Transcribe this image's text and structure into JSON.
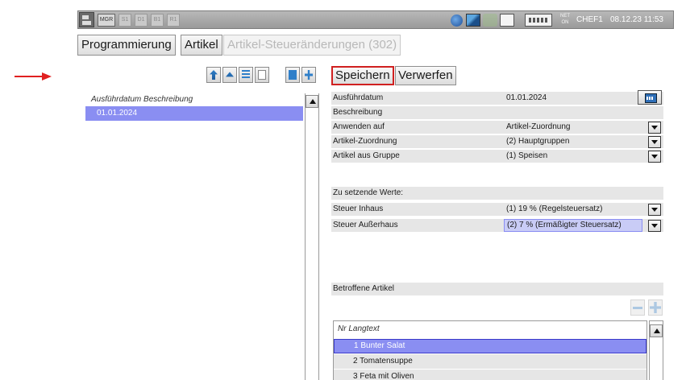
{
  "topbar": {
    "modes": [
      "MGR",
      "S1",
      "D1",
      "B1",
      "R1"
    ],
    "net_line1": "NET",
    "net_line2": "ON",
    "user": "CHEF1",
    "datetime": "08.12.23 11:53"
  },
  "breadcrumb": [
    "Programmierung",
    "Artikel",
    "Artikel-Steueränderungen (302)"
  ],
  "toolbar": {
    "save_label": "Speichern",
    "discard_label": "Verwerfen"
  },
  "list": {
    "header": "Ausführdatum Beschreibung",
    "rows": [
      "01.01.2024"
    ]
  },
  "form": {
    "rows": [
      {
        "label": "Ausführdatum",
        "value": "01.01.2024"
      },
      {
        "label": "Beschreibung",
        "value": ""
      },
      {
        "label": "Anwenden auf",
        "value": "Artikel-Zuordnung"
      },
      {
        "label": "Artikel-Zuordnung",
        "value": "(2) Hauptgruppen"
      },
      {
        "label": "Artikel aus Gruppe",
        "value": "(1) Speisen"
      }
    ],
    "values_section": "Zu setzende Werte:",
    "tax_rows": [
      {
        "label": "Steuer Inhaus",
        "value": "(1) 19 % (Regelsteuersatz)"
      },
      {
        "label": "Steuer Außerhaus",
        "value": "(2) 7 % (Ermäßigter Steuersatz)"
      }
    ]
  },
  "affected": {
    "title": "Betroffene Artikel",
    "header": "Nr  Langtext",
    "items": [
      "1  Bunter Salat",
      "2  Tomatensuppe",
      "3  Feta mit Oliven"
    ]
  },
  "colors": {
    "selection": "#8a8ef2",
    "primary_border": "#d02020",
    "arrow": "#e02020"
  }
}
